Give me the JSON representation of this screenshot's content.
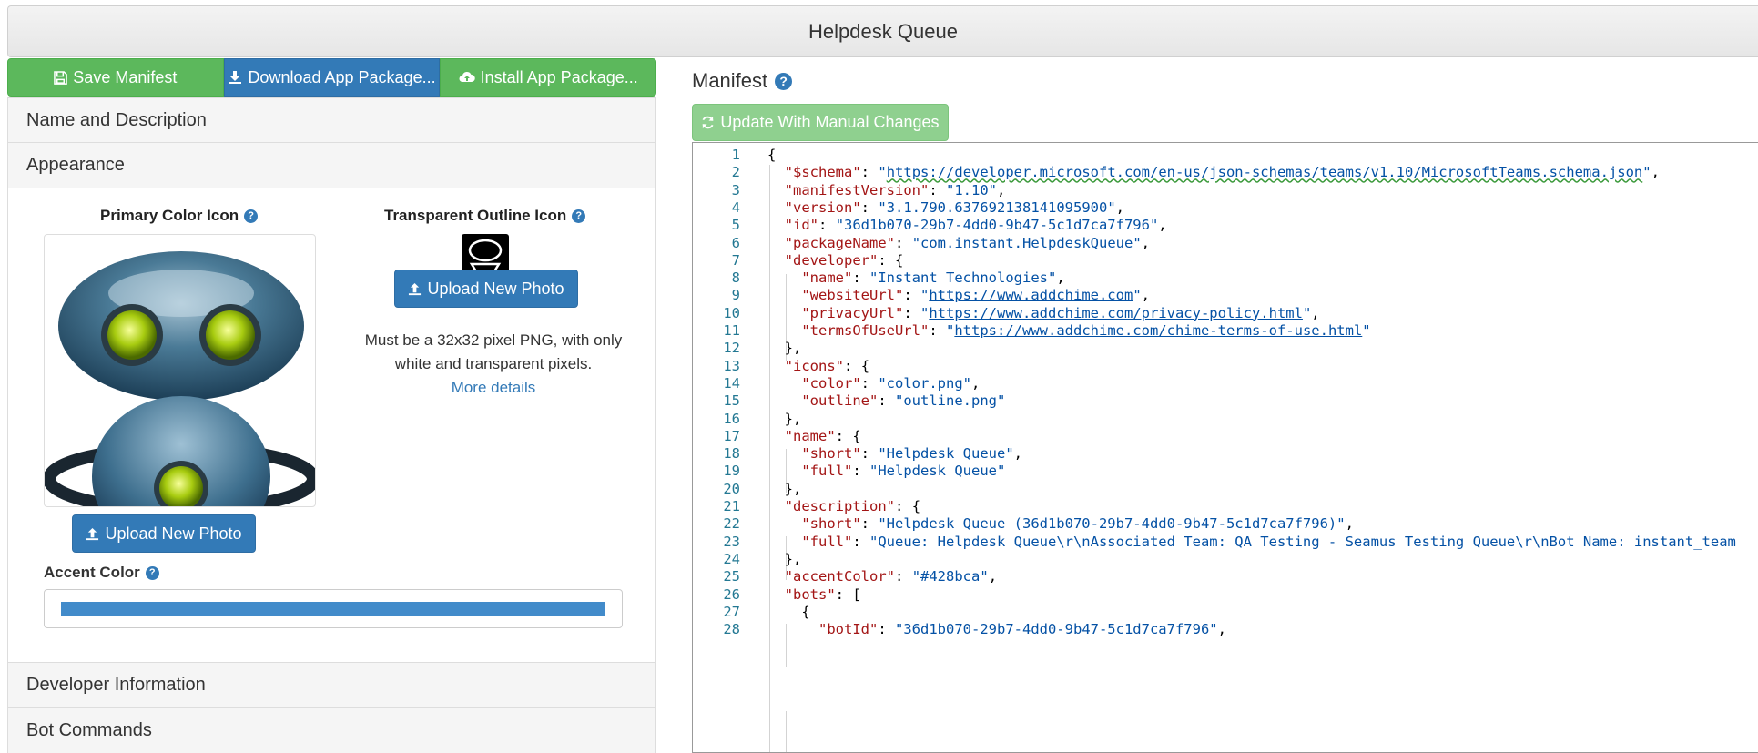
{
  "header": {
    "title": "Helpdesk Queue"
  },
  "toolbar": {
    "save_label": "Save Manifest",
    "download_label": "Download App Package...",
    "install_label": "Install App Package..."
  },
  "sections": {
    "name_description": "Name and Description",
    "appearance": "Appearance",
    "developer": "Developer Information",
    "bot_commands": "Bot Commands"
  },
  "appearance": {
    "primary_title": "Primary Color Icon",
    "outline_title": "Transparent Outline Icon",
    "upload_label": "Upload New Photo",
    "outline_help_line1": "Must be a 32x32 pixel PNG, with only",
    "outline_help_line2": "white and transparent pixels.",
    "more_details": "More details",
    "accent_label": "Accent Color",
    "accent_color": "#428bca"
  },
  "manifest": {
    "title": "Manifest",
    "update_label": "Update With Manual Changes",
    "lines": [
      "{",
      "  \"$schema\": \"https://developer.microsoft.com/en-us/json-schemas/teams/v1.10/MicrosoftTeams.schema.json\",",
      "  \"manifestVersion\": \"1.10\",",
      "  \"version\": \"3.1.790.637692138141095900\",",
      "  \"id\": \"36d1b070-29b7-4dd0-9b47-5c1d7ca7f796\",",
      "  \"packageName\": \"com.instant.HelpdeskQueue\",",
      "  \"developer\": {",
      "    \"name\": \"Instant Technologies\",",
      "    \"websiteUrl\": \"https://www.addchime.com\",",
      "    \"privacyUrl\": \"https://www.addchime.com/privacy-policy.html\",",
      "    \"termsOfUseUrl\": \"https://www.addchime.com/chime-terms-of-use.html\"",
      "  },",
      "  \"icons\": {",
      "    \"color\": \"color.png\",",
      "    \"outline\": \"outline.png\"",
      "  },",
      "  \"name\": {",
      "    \"short\": \"Helpdesk Queue\",",
      "    \"full\": \"Helpdesk Queue\"",
      "  },",
      "  \"description\": {",
      "    \"short\": \"Helpdesk Queue (36d1b070-29b7-4dd0-9b47-5c1d7ca7f796)\",",
      "    \"full\": \"Queue: Helpdesk Queue\\r\\nAssociated Team: QA Testing - Seamus Testing Queue\\r\\nBot Name: instant_team",
      "  },",
      "  \"accentColor\": \"#428bca\",",
      "  \"bots\": [",
      "    {",
      "      \"botId\": \"36d1b070-29b7-4dd0-9b47-5c1d7ca7f796\","
    ]
  },
  "icons": {
    "save": "save-icon",
    "download": "download-icon",
    "install": "cloud-upload-icon",
    "upload": "upload-icon",
    "help": "question-circle-icon",
    "refresh": "refresh-icon"
  }
}
